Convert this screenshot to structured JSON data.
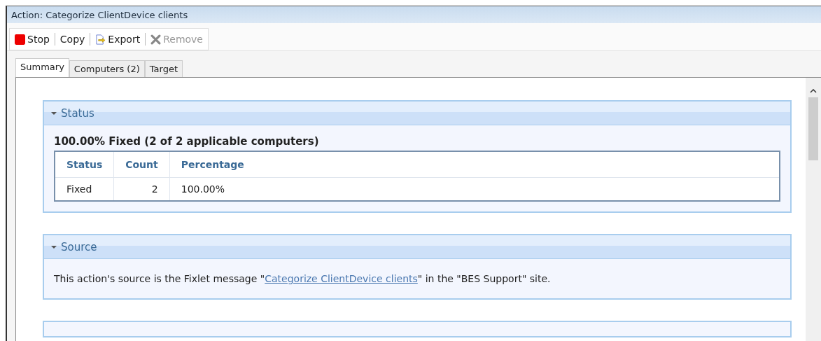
{
  "window": {
    "title": "Action: Categorize ClientDevice clients"
  },
  "toolbar": [
    {
      "label": "Stop",
      "kind": "stop",
      "disabled": false
    },
    {
      "label": "Copy",
      "kind": "plain",
      "disabled": false
    },
    {
      "label": "Export",
      "kind": "export",
      "disabled": false
    },
    {
      "label": "Remove",
      "kind": "remove",
      "disabled": true
    }
  ],
  "tabs": [
    {
      "label": "Summary",
      "selected": true
    },
    {
      "label": "Computers (2)",
      "selected": false
    },
    {
      "label": "Target",
      "selected": false
    }
  ],
  "sections": [
    {
      "kind": "status",
      "title": "Status",
      "expanded": true,
      "headline": "100.00% Fixed (2 of 2 applicable computers)",
      "columns": [
        "Status",
        "Count",
        "Percentage"
      ],
      "rows": [
        [
          "Fixed",
          "2",
          "100.00%"
        ]
      ]
    },
    {
      "kind": "source",
      "title": "Source",
      "expanded": true,
      "text_before": "This action's source is the Fixlet message \"",
      "link": "Categorize ClientDevice clients",
      "text_after": "\" in the \"BES Support\" site."
    }
  ]
}
